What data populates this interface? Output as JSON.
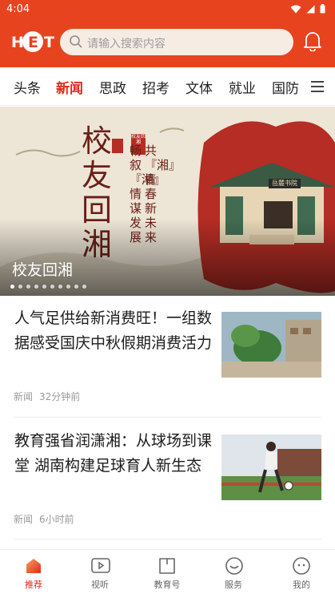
{
  "status": {
    "time": "4:04"
  },
  "header": {
    "logo_text": "HET",
    "search_placeholder": "请输入搜索内容"
  },
  "tabs": [
    {
      "label": "头条"
    },
    {
      "label": "新闻",
      "active": true
    },
    {
      "label": "思政"
    },
    {
      "label": "招考"
    },
    {
      "label": "文体"
    },
    {
      "label": "就业"
    },
    {
      "label": "国防"
    }
  ],
  "banner": {
    "caption": "校友回湘",
    "poster_title": "校友回湘",
    "poster_side_lines": [
      "共『湘』青春新未来",
      "畅叙『湘』情谋发展"
    ],
    "seal_text": "校友回湘",
    "building_sign": "岳麓书院",
    "slide_count": 10,
    "active_slide": 1
  },
  "news": [
    {
      "title": "人气足供给新消费旺！一组数据感受国庆中秋假期消费活力",
      "category": "新闻",
      "time": "32分钟前"
    },
    {
      "title": "教育强省润潇湘：从球场到课堂 湖南构建足球育人新生态",
      "category": "新闻",
      "time": "6小时前"
    }
  ],
  "bottom_nav": [
    {
      "label": "推荐",
      "icon": "recommend-icon",
      "active": true
    },
    {
      "label": "视听",
      "icon": "video-icon"
    },
    {
      "label": "教育号",
      "icon": "book-icon"
    },
    {
      "label": "服务",
      "icon": "heart-icon"
    },
    {
      "label": "我的",
      "icon": "profile-icon"
    }
  ],
  "colors": {
    "brand": "#e8431f",
    "active_text": "#e0291b"
  }
}
